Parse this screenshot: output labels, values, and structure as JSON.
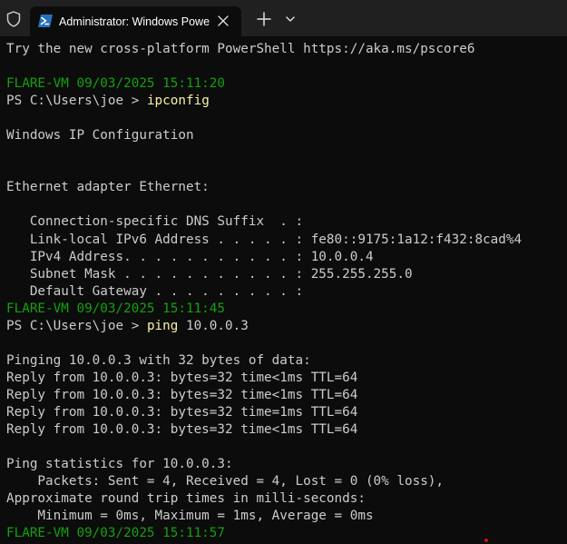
{
  "window": {
    "tab_title": "Administrator: Windows PowerShell"
  },
  "icons": {
    "shield": "shield-icon",
    "powershell": "powershell-icon",
    "close": "close-icon",
    "add": "plus-icon",
    "dropdown": "chevron-down-icon"
  },
  "colors": {
    "background": "#0c0c0c",
    "titlebar": "#202020",
    "text": "#cccccc",
    "prompt_green": "#13a10e",
    "command_yellow": "#f9f1a5"
  },
  "terminal": {
    "lines": [
      [
        {
          "text": "Try the new cross-platform PowerShell https://aka.ms/pscore6",
          "color": "gray"
        }
      ],
      [
        {
          "text": "",
          "color": "gray"
        }
      ],
      [
        {
          "text": "FLARE-VM 09/03/2025 15:11:20",
          "color": "green"
        }
      ],
      [
        {
          "text": "PS C:\\Users\\joe > ",
          "color": "gray"
        },
        {
          "text": "ipconfig",
          "color": "yellow"
        }
      ],
      [
        {
          "text": "",
          "color": "gray"
        }
      ],
      [
        {
          "text": "Windows IP Configuration",
          "color": "gray"
        }
      ],
      [
        {
          "text": "",
          "color": "gray"
        }
      ],
      [
        {
          "text": "",
          "color": "gray"
        }
      ],
      [
        {
          "text": "Ethernet adapter Ethernet:",
          "color": "gray"
        }
      ],
      [
        {
          "text": "",
          "color": "gray"
        }
      ],
      [
        {
          "text": "   Connection-specific DNS Suffix  . :",
          "color": "gray"
        }
      ],
      [
        {
          "text": "   Link-local IPv6 Address . . . . . : fe80::9175:1a12:f432:8cad%4",
          "color": "gray"
        }
      ],
      [
        {
          "text": "   IPv4 Address. . . . . . . . . . . : 10.0.0.4",
          "color": "gray"
        }
      ],
      [
        {
          "text": "   Subnet Mask . . . . . . . . . . . : 255.255.255.0",
          "color": "gray"
        }
      ],
      [
        {
          "text": "   Default Gateway . . . . . . . . . :",
          "color": "gray"
        }
      ],
      [
        {
          "text": "FLARE-VM 09/03/2025 15:11:45",
          "color": "green"
        }
      ],
      [
        {
          "text": "PS C:\\Users\\joe > ",
          "color": "gray"
        },
        {
          "text": "ping",
          "color": "yellow"
        },
        {
          "text": " 10.0.0.3",
          "color": "gray"
        }
      ],
      [
        {
          "text": "",
          "color": "gray"
        }
      ],
      [
        {
          "text": "Pinging 10.0.0.3 with 32 bytes of data:",
          "color": "gray"
        }
      ],
      [
        {
          "text": "Reply from 10.0.0.3: bytes=32 time<1ms TTL=64",
          "color": "gray"
        }
      ],
      [
        {
          "text": "Reply from 10.0.0.3: bytes=32 time<1ms TTL=64",
          "color": "gray"
        }
      ],
      [
        {
          "text": "Reply from 10.0.0.3: bytes=32 time=1ms TTL=64",
          "color": "gray"
        }
      ],
      [
        {
          "text": "Reply from 10.0.0.3: bytes=32 time<1ms TTL=64",
          "color": "gray"
        }
      ],
      [
        {
          "text": "",
          "color": "gray"
        }
      ],
      [
        {
          "text": "Ping statistics for 10.0.0.3:",
          "color": "gray"
        }
      ],
      [
        {
          "text": "    Packets: Sent = 4, Received = 4, Lost = 0 (0% loss),",
          "color": "gray"
        }
      ],
      [
        {
          "text": "Approximate round trip times in milli-seconds:",
          "color": "gray"
        }
      ],
      [
        {
          "text": "    Minimum = 0ms, Maximum = 1ms, Average = 0ms",
          "color": "gray"
        }
      ],
      [
        {
          "text": "FLARE-VM 09/03/2025 15:11:57",
          "color": "green"
        }
      ]
    ]
  }
}
